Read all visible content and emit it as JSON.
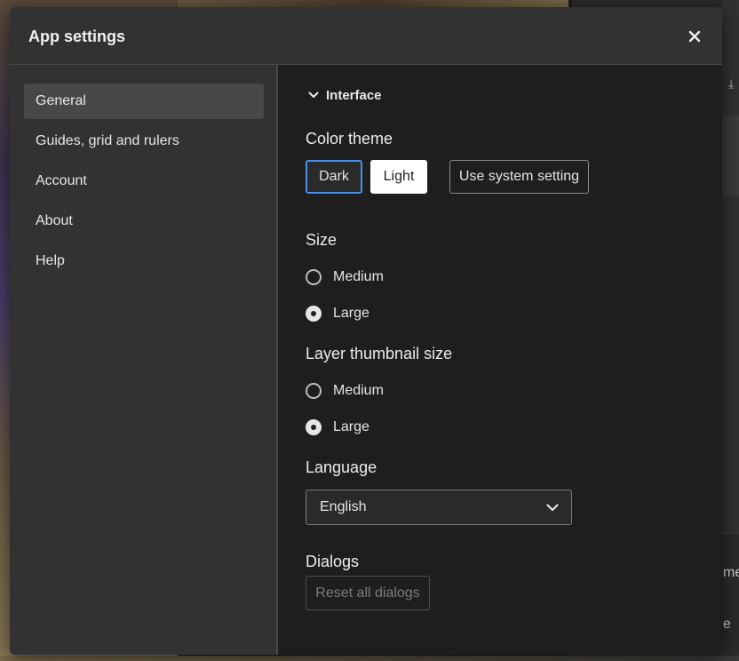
{
  "dialog": {
    "title": "App settings",
    "close_icon": "close-icon"
  },
  "sidebar": {
    "items": [
      {
        "label": "General",
        "active": true
      },
      {
        "label": "Guides, grid and rulers",
        "active": false
      },
      {
        "label": "Account",
        "active": false
      },
      {
        "label": "About",
        "active": false
      },
      {
        "label": "Help",
        "active": false
      }
    ]
  },
  "interface": {
    "section_label": "Interface",
    "expanded": true,
    "color_theme": {
      "heading": "Color theme",
      "options": [
        "Dark",
        "Light",
        "Use system setting"
      ],
      "selected": "Dark"
    },
    "size": {
      "heading": "Size",
      "options": [
        "Medium",
        "Large"
      ],
      "selected": "Large"
    },
    "layer_thumbnail_size": {
      "heading": "Layer thumbnail size",
      "options": [
        "Medium",
        "Large"
      ],
      "selected": "Large"
    },
    "language": {
      "heading": "Language",
      "value": "English"
    },
    "dialogs": {
      "heading": "Dialogs",
      "reset_label": "Reset all dialogs",
      "reset_enabled": false
    }
  },
  "background": {
    "right_text_1": "me",
    "right_text_2": "e"
  },
  "colors": {
    "accent": "#4b8ee8",
    "dialog_bg": "#1e1e1e",
    "panel_bg": "#323232"
  }
}
